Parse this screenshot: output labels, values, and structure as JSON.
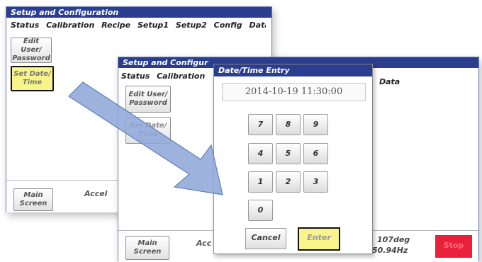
{
  "window": {
    "title": "Setup and Configuration",
    "menu": [
      "Status",
      "Calibration",
      "Recipe",
      "Setup1",
      "Setup2",
      "Config",
      "Data"
    ]
  },
  "back_panel": {
    "edit_user_button": "Edit User/ Password",
    "set_date_time_button": "Set Date/ Time",
    "main_screen_button": "Main Screen",
    "bottom_label": "Accel"
  },
  "front_panel": {
    "title": "Setup and Configur",
    "menu": [
      "Status",
      "Calibration"
    ],
    "data_tab": "Data",
    "edit_user_button": "Edit User/ Password",
    "set_date_time_button": "Set Date/ Time",
    "main_screen_button": "Main Screen",
    "bottom_label": "Acc",
    "readout_temp": "107deg",
    "readout_freq": "50.94Hz",
    "stop_button": "Stop"
  },
  "dialog": {
    "title": "Date/Time Entry",
    "datetime_value": "2014-10-19 11:30:00",
    "keys": [
      "7",
      "8",
      "9",
      "4",
      "5",
      "6",
      "1",
      "2",
      "3",
      "0"
    ],
    "cancel_label": "Cancel",
    "enter_label": "Enter"
  },
  "colors": {
    "titlebar": "#2a3d8f",
    "highlight_yellow": "#f8f48a",
    "stop_red": "#e8203a",
    "arrow_blue": "#8fa9d8"
  }
}
